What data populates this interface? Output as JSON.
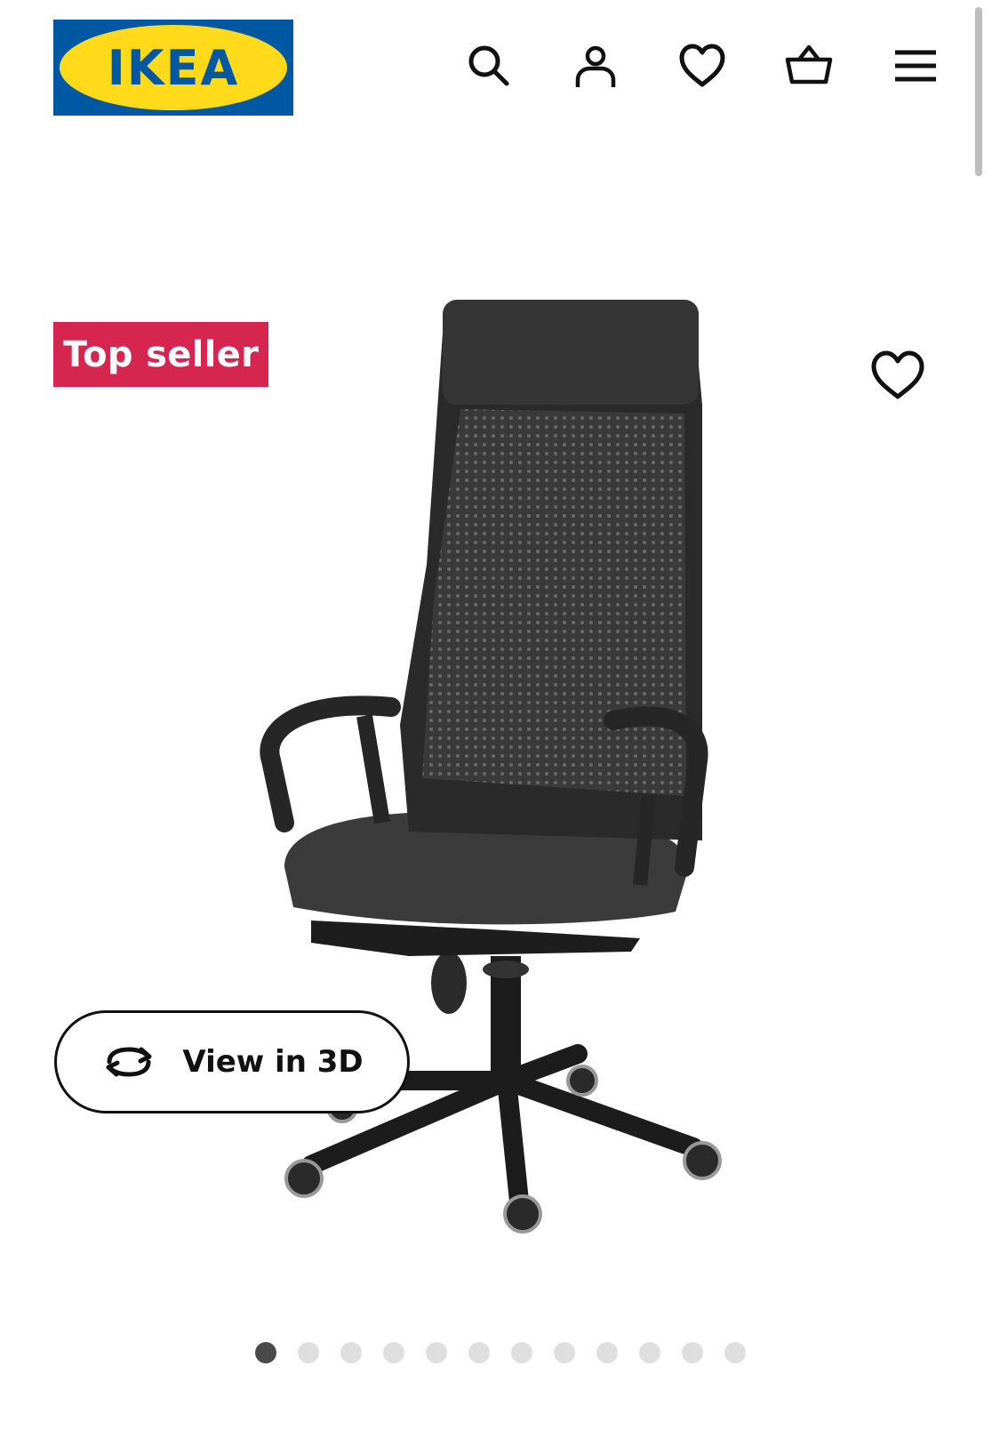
{
  "header": {
    "logo_text": "IKEA",
    "icons": [
      "search-icon",
      "account-icon",
      "heart-icon",
      "basket-icon",
      "menu-icon"
    ]
  },
  "product": {
    "badge": "Top seller",
    "view_3d_label": "View in 3D",
    "image_icon": "office-chair-image"
  },
  "carousel": {
    "total": 12,
    "active_index": 0
  },
  "colors": {
    "ikea_blue": "#0058A3",
    "ikea_yellow": "#FFDA1A",
    "badge_red": "#D6264F"
  }
}
